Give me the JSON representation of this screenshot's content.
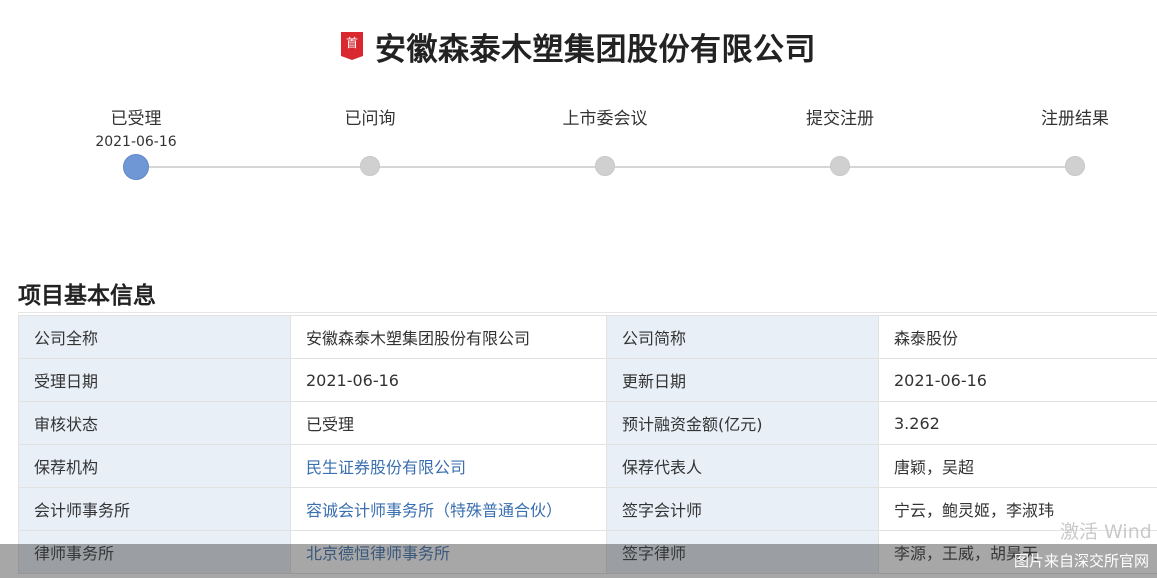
{
  "header": {
    "badge_label": "首",
    "company_title": "安徽森泰木塑集团股份有限公司"
  },
  "progress": {
    "steps": [
      {
        "label": "已受理",
        "date": "2021-06-16",
        "status": "active"
      },
      {
        "label": "已问询",
        "date": "",
        "status": "pending"
      },
      {
        "label": "上市委会议",
        "date": "",
        "status": "pending"
      },
      {
        "label": "提交注册",
        "date": "",
        "status": "pending"
      },
      {
        "label": "注册结果",
        "date": "",
        "status": "pending"
      }
    ],
    "active_color": "#6f97d6",
    "pending_color": "#d0d0d0"
  },
  "section": {
    "title": "项目基本信息"
  },
  "info_table": {
    "rows": [
      {
        "label1": "公司全称",
        "value1": "安徽森泰木塑集团股份有限公司",
        "label2": "公司简称",
        "value2": "森泰股份"
      },
      {
        "label1": "受理日期",
        "value1": "2021-06-16",
        "label2": "更新日期",
        "value2": "2021-06-16"
      },
      {
        "label1": "审核状态",
        "value1": "已受理",
        "label2": "预计融资金额(亿元)",
        "value2": "3.262"
      },
      {
        "label1": "保荐机构",
        "value1": "民生证券股份有限公司",
        "label2": "保荐代表人",
        "value2": "唐颖，吴超"
      },
      {
        "label1": "会计师事务所",
        "value1": "容诚会计师事务所（特殊普通合伙）",
        "label2": "签字会计师",
        "value2": "宁云，鲍灵姬，李淑玮"
      },
      {
        "label1": "律师事务所",
        "value1": "北京德恒律师事务所",
        "label2": "签字律师",
        "value2": "李源，王威，胡昊天"
      }
    ],
    "label_bg": "#e9eff7",
    "link_color": "#3a6fb0"
  },
  "overlay": {
    "watermark": "激活 Wind",
    "source_caption": "图片来自深交所官网"
  }
}
